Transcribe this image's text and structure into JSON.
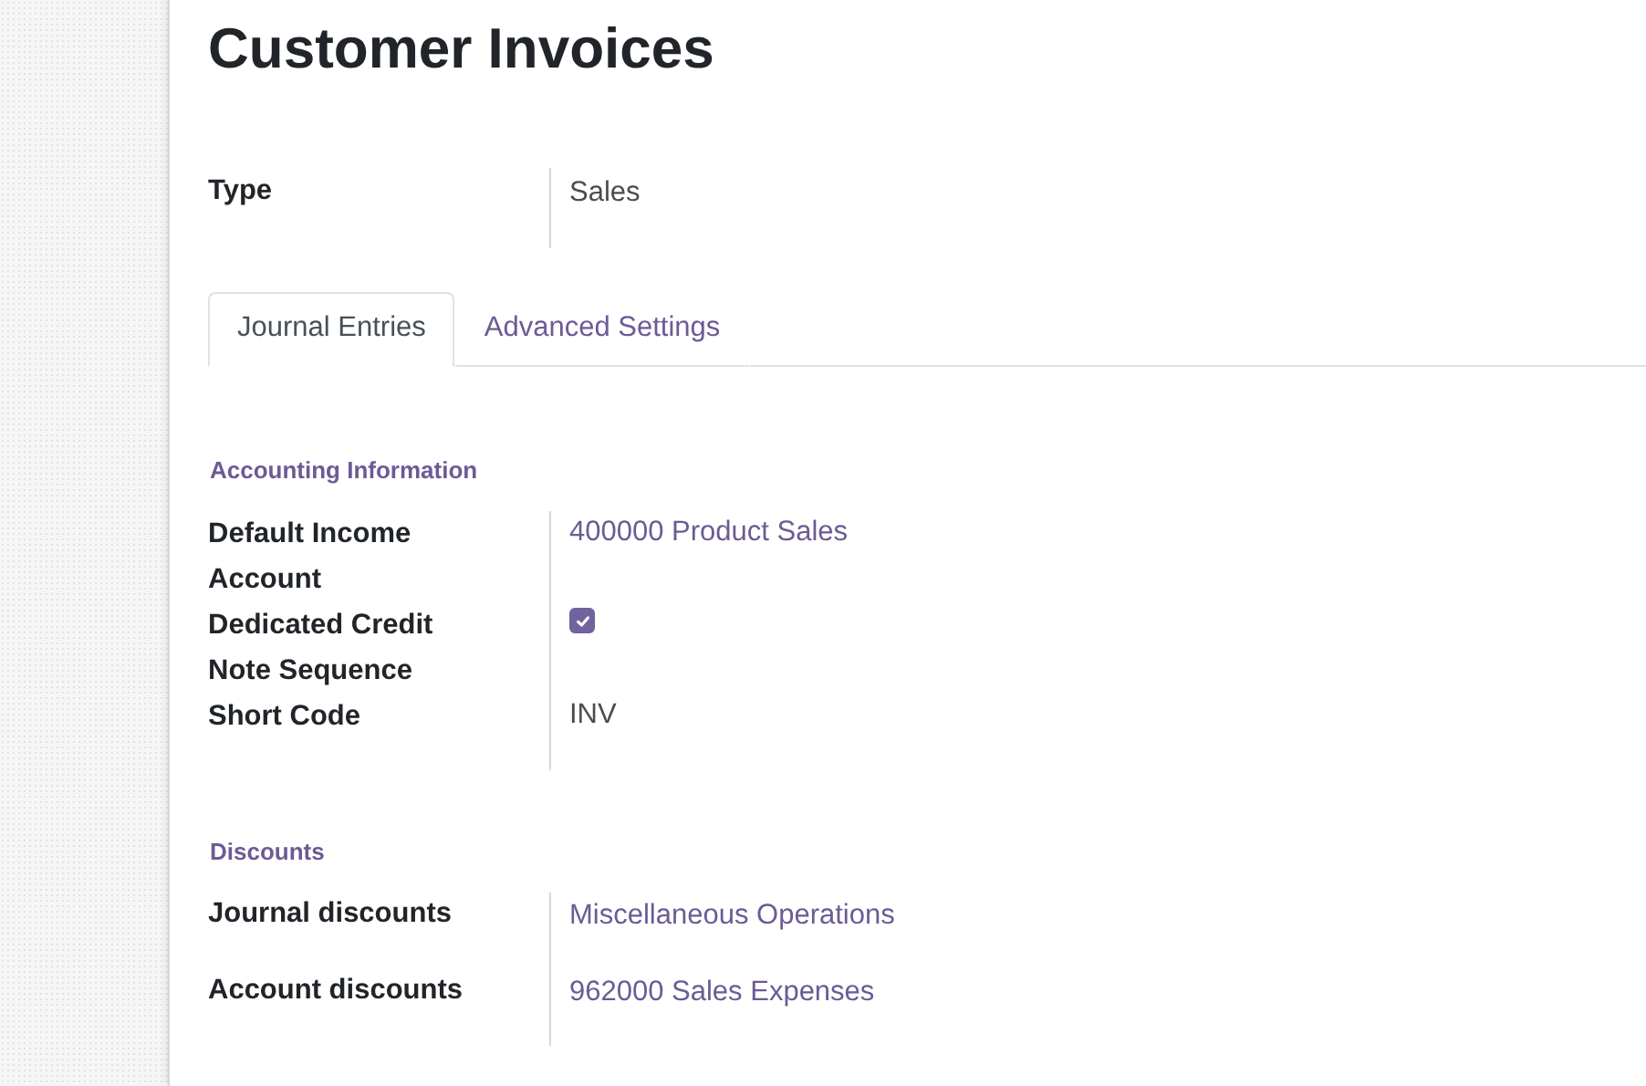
{
  "title": "Customer Invoices",
  "top_fields": [
    {
      "label": "Type",
      "kind": "text",
      "value": "Sales"
    }
  ],
  "tabs": [
    {
      "label": "Journal Entries",
      "selected": true
    },
    {
      "label": "Advanced Settings",
      "selected": false
    }
  ],
  "sections": [
    {
      "heading": "Accounting Information",
      "fields": [
        {
          "label": "Default Income Account",
          "kind": "link",
          "value": "400000 Product Sales"
        },
        {
          "label": "Dedicated Credit Note Sequence",
          "kind": "checkbox",
          "checked": true
        },
        {
          "label": "Short Code",
          "kind": "text",
          "value": "INV"
        }
      ]
    },
    {
      "heading": "Discounts",
      "fields": [
        {
          "label": "Journal discounts",
          "kind": "link",
          "value": "Miscellaneous Operations"
        },
        {
          "label": "Account discounts",
          "kind": "link",
          "value": "962000 Sales Expenses"
        }
      ]
    }
  ]
}
